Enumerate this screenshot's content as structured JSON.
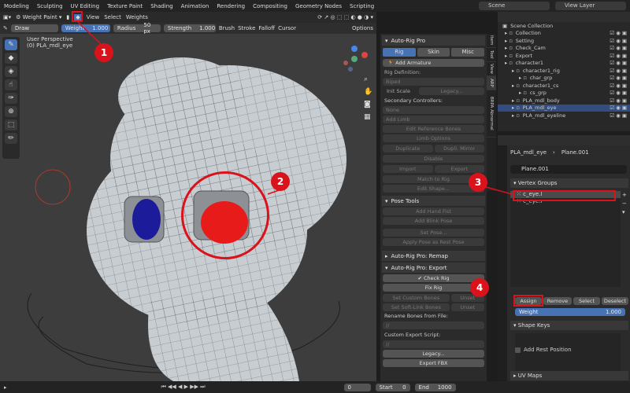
{
  "menu": [
    "Modeling",
    "Sculpting",
    "UV Editing",
    "Texture Paint",
    "Shading",
    "Animation",
    "Rendering",
    "Compositing",
    "Geometry Nodes",
    "Scripting"
  ],
  "scene": "Scene",
  "view_layer": "View Layer",
  "header": {
    "mode": "Weight Paint",
    "menus": [
      "View",
      "Select",
      "Weights"
    ]
  },
  "tool": {
    "brush": "Draw",
    "weight_label": "Weight",
    "weight": "1.000",
    "radius_label": "Radius",
    "radius": "50 px",
    "strength_label": "Strength",
    "strength": "1.000",
    "dd": [
      "Brush",
      "Stroke",
      "Falloff",
      "Cursor"
    ],
    "options": "Options"
  },
  "viewport": {
    "persp": "User Perspective",
    "obj": "(0) PLA_mdl_eye"
  },
  "npanel": {
    "title": "Auto-Rig Pro",
    "tabs": [
      "Rig",
      "Skin",
      "Misc"
    ],
    "add_armature": "Add Armature",
    "rig_def": "Rig Definition:",
    "biped": "Biped",
    "init_scale": "Init Scale",
    "legacy": "Legacy...",
    "sec": "Secondary Controllers:",
    "none": "None",
    "add_limb": "Add Limb",
    "edit_ref": "Edit Reference Bones",
    "limb_opts": "Limb Options",
    "duplicate": "Duplicate",
    "dupli_mirror": "Dupli. Mirror",
    "disable": "Disable",
    "import": "Import",
    "export": "Export",
    "match": "Match to Rig",
    "edit_shape": "Edit Shape...",
    "pose_tools": "Pose Tools",
    "add_hand": "Add Hand Fist",
    "add_blink": "Add Blink Pose",
    "set_pose": "Set Pose...",
    "apply_pose": "Apply Pose as Rest Pose",
    "remap": "Auto-Rig Pro: Remap",
    "exp": "Auto-Rig Pro: Export",
    "check_rig": "Check Rig",
    "fix_rig": "Fix Rig",
    "set_custom": "Set Custom Bones",
    "unset": "Unset",
    "set_soft": "Set Soft-Link Bones",
    "unset2": "Unset",
    "rename": "Rename Bones from File:",
    "slash": "//",
    "custom_exp": "Custom Export Script:",
    "slash2": "//",
    "legacy2": "Legacy...",
    "export_fbx": "Export FBX"
  },
  "vtabs": [
    "Item",
    "Tool",
    "View",
    "ARP",
    "BRPA Abnormal"
  ],
  "outliner": {
    "title": "Scene Collection",
    "rows": [
      {
        "label": "Collection",
        "depth": 1,
        "sel": false
      },
      {
        "label": "Setting",
        "depth": 1,
        "sel": false
      },
      {
        "label": "Check_Cam",
        "depth": 1,
        "sel": false
      },
      {
        "label": "Export",
        "depth": 1,
        "sel": false
      },
      {
        "label": "character1",
        "depth": 1,
        "sel": false
      },
      {
        "label": "character1_rig",
        "depth": 2,
        "sel": false
      },
      {
        "label": "char_grp",
        "depth": 3,
        "sel": false
      },
      {
        "label": "character1_cs",
        "depth": 2,
        "sel": false
      },
      {
        "label": "cs_grp",
        "depth": 3,
        "sel": false
      },
      {
        "label": "PLA_mdl_body",
        "depth": 2,
        "sel": false
      },
      {
        "label": "PLA_mdl_eye",
        "depth": 2,
        "sel": true
      },
      {
        "label": "PLA_mdl_eyeline",
        "depth": 2,
        "sel": false
      }
    ]
  },
  "props": {
    "obj": "PLA_mdl_eye",
    "mesh": "Plane.001",
    "mesh2": "Plane.001",
    "vg_title": "Vertex Groups",
    "groups": [
      "c_eye.l",
      "c_eye.r"
    ],
    "assign": "Assign",
    "remove": "Remove",
    "select": "Select",
    "deselect": "Deselect",
    "weight_label": "Weight",
    "weight": "1.000",
    "shape_keys": "Shape Keys",
    "add_rest": "Add Rest Position",
    "uv_maps": "UV Maps"
  },
  "timeline": {
    "frame": "0",
    "start_label": "Start",
    "start": "0",
    "end_label": "End",
    "end": "1000"
  },
  "annotations": [
    "1",
    "2",
    "3",
    "4"
  ]
}
